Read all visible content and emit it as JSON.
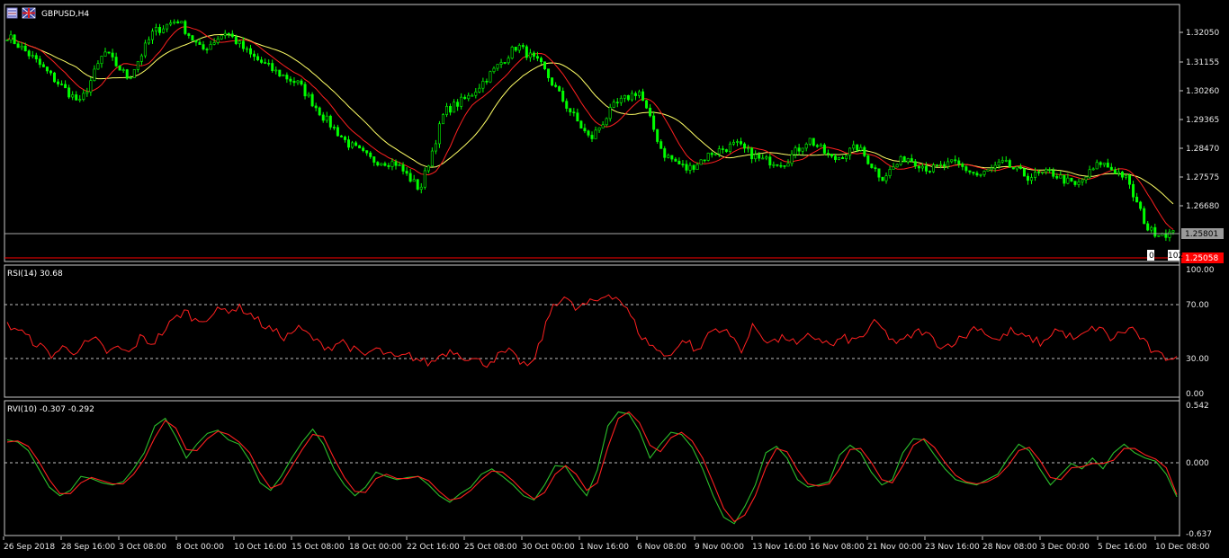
{
  "chart_title": "GBPUSD,H4",
  "colors": {
    "background": "#000000",
    "frame": "#c8c8c8",
    "bull_candle": "#00ff00",
    "bear_candle": "#00ff00",
    "ma_fast": "#ff2020",
    "ma_slow": "#ffff66",
    "rsi_line": "#ff2020",
    "rvi_main": "#2bbf2b",
    "rvi_signal": "#ff2020",
    "level_line": "#bfbfbf",
    "price_line": "#a8a8a8",
    "ask_line": "#ff0000",
    "ask_badge": "#ff0000",
    "bid_badge": "#9a9a9a"
  },
  "icons": [
    "chart-window-icon",
    "currency-flag-icon"
  ],
  "price_panel": {
    "y_ticks": [
      "1.32050",
      "1.31155",
      "1.30260",
      "1.29365",
      "1.28470",
      "1.27575",
      "1.26680"
    ],
    "bid_label": "1.25801",
    "ask_label": "1.25058",
    "corner_label": "0",
    "corner_label_2": "102"
  },
  "rsi_panel": {
    "label": "RSI(14) 30.68",
    "y_ticks": [
      "100.00",
      "70.00",
      "30.00",
      "0.00"
    ]
  },
  "rvi_panel": {
    "label": "RVI(10) -0.307 -0.292",
    "y_ticks": [
      "0.542",
      "0.000",
      "-0.637"
    ]
  },
  "x_ticks": [
    "26 Sep 2018",
    "28 Sep 16:00",
    "3 Oct 08:00",
    "8 Oct 00:00",
    "10 Oct 16:00",
    "15 Oct 08:00",
    "18 Oct 00:00",
    "22 Oct 16:00",
    "25 Oct 08:00",
    "30 Oct 00:00",
    "1 Nov 16:00",
    "6 Nov 08:00",
    "9 Nov 00:00",
    "13 Nov 16:00",
    "16 Nov 08:00",
    "21 Nov 00:00",
    "23 Nov 16:00",
    "28 Nov 08:00",
    "3 Dec 00:00",
    "5 Dec 16:00",
    "10 Dec 08:00"
  ],
  "chart_data": [
    {
      "type": "candlestick",
      "title": "GBPUSD,H4",
      "ylim": [
        1.2505,
        1.3255
      ],
      "x": [
        "26 Sep 2018",
        "28 Sep 16:00",
        "3 Oct 08:00",
        "8 Oct 00:00",
        "10 Oct 16:00",
        "15 Oct 08:00",
        "18 Oct 00:00",
        "22 Oct 16:00",
        "25 Oct 08:00",
        "30 Oct 00:00",
        "1 Nov 16:00",
        "6 Nov 08:00",
        "9 Nov 00:00",
        "13 Nov 16:00",
        "16 Nov 08:00",
        "21 Nov 00:00",
        "23 Nov 16:00",
        "28 Nov 08:00",
        "3 Dec 00:00",
        "5 Dec 16:00",
        "10 Dec 08:00"
      ],
      "close_path": [
        1.3195,
        1.313,
        1.3055,
        1.2985,
        1.3145,
        1.3062,
        1.3205,
        1.3245,
        1.3148,
        1.3208,
        1.3135,
        1.3085,
        1.3045,
        1.2945,
        1.2862,
        1.281,
        1.28,
        1.2718,
        1.296,
        1.3005,
        1.3085,
        1.3165,
        1.31,
        1.298,
        1.2872,
        1.2978,
        1.3025,
        1.283,
        1.278,
        1.2832,
        1.2858,
        1.281,
        1.2802,
        1.2875,
        1.281,
        1.285,
        1.2755,
        1.282,
        1.278,
        1.28,
        1.276,
        1.28,
        1.2758,
        1.277,
        1.2728,
        1.2802,
        1.276,
        1.259,
        1.258
      ],
      "bid": 1.25801,
      "ask": 1.25058
    },
    {
      "type": "line",
      "title": "RSI(14) 30.68",
      "ylim": [
        0,
        100
      ],
      "levels": [
        70,
        30
      ],
      "y_ticks": [
        100,
        70,
        30,
        0
      ],
      "values": [
        55,
        52,
        44,
        38,
        31,
        37,
        34,
        40,
        43,
        33,
        37,
        32,
        46,
        40,
        50,
        60,
        67,
        58,
        62,
        67,
        68,
        69,
        63,
        55,
        50,
        45,
        53,
        48,
        40,
        37,
        43,
        36,
        30,
        36,
        32,
        28,
        31,
        27,
        24,
        32,
        35,
        30,
        27,
        24,
        30,
        34,
        26,
        21,
        45,
        72,
        78,
        68,
        72,
        75,
        81,
        76,
        62,
        45,
        38,
        30,
        36,
        44,
        32,
        50,
        53,
        46,
        35,
        55,
        44,
        42,
        46,
        38,
        47,
        44,
        38,
        45,
        42,
        48,
        58,
        47,
        40,
        46,
        51,
        45,
        37,
        42,
        46,
        55,
        48,
        42,
        51,
        46,
        44,
        40,
        52,
        48,
        43,
        50,
        54,
        44,
        49,
        53,
        42,
        32,
        29,
        31
      ]
    },
    {
      "type": "line",
      "title": "RVI(10) -0.307 -0.292",
      "ylim": [
        -0.637,
        0.542
      ],
      "levels": [
        0
      ],
      "y_ticks": [
        0.542,
        0.0,
        -0.637
      ],
      "series": [
        {
          "name": "RVI(10)",
          "values": [
            0.22,
            0.2,
            0.12,
            -0.05,
            -0.22,
            -0.3,
            -0.25,
            -0.12,
            -0.14,
            -0.18,
            -0.2,
            -0.17,
            -0.05,
            0.1,
            0.35,
            0.42,
            0.25,
            0.05,
            0.18,
            0.28,
            0.31,
            0.22,
            0.18,
            0.03,
            -0.18,
            -0.25,
            -0.12,
            0.05,
            0.2,
            0.32,
            0.18,
            -0.05,
            -0.2,
            -0.3,
            -0.22,
            -0.08,
            -0.12,
            -0.15,
            -0.13,
            -0.12,
            -0.2,
            -0.3,
            -0.36,
            -0.28,
            -0.22,
            -0.1,
            -0.05,
            -0.12,
            -0.2,
            -0.3,
            -0.34,
            -0.2,
            -0.02,
            -0.03,
            -0.18,
            -0.3,
            -0.06,
            0.35,
            0.48,
            0.46,
            0.3,
            0.05,
            0.18,
            0.29,
            0.27,
            0.15,
            -0.05,
            -0.3,
            -0.5,
            -0.56,
            -0.4,
            -0.2,
            0.1,
            0.16,
            0.05,
            -0.15,
            -0.22,
            -0.2,
            -0.17,
            0.08,
            0.17,
            0.1,
            -0.08,
            -0.2,
            -0.15,
            0.1,
            0.23,
            0.22,
            0.08,
            -0.05,
            -0.15,
            -0.18,
            -0.2,
            -0.15,
            -0.1,
            0.05,
            0.18,
            0.12,
            -0.05,
            -0.2,
            -0.1,
            0.0,
            -0.05,
            0.05,
            -0.05,
            0.1,
            0.18,
            0.1,
            0.05,
            0.02,
            -0.1,
            -0.31
          ]
        },
        {
          "name": "Signal",
          "values": [
            0.2,
            0.21,
            0.16,
            0.02,
            -0.15,
            -0.28,
            -0.28,
            -0.18,
            -0.13,
            -0.16,
            -0.19,
            -0.19,
            -0.1,
            0.04,
            0.24,
            0.4,
            0.33,
            0.13,
            0.12,
            0.23,
            0.3,
            0.27,
            0.2,
            0.1,
            -0.09,
            -0.23,
            -0.19,
            -0.03,
            0.13,
            0.27,
            0.25,
            0.05,
            -0.13,
            -0.26,
            -0.27,
            -0.14,
            -0.1,
            -0.14,
            -0.14,
            -0.12,
            -0.16,
            -0.26,
            -0.34,
            -0.32,
            -0.25,
            -0.15,
            -0.07,
            -0.08,
            -0.16,
            -0.26,
            -0.33,
            -0.27,
            -0.1,
            -0.02,
            -0.1,
            -0.25,
            -0.18,
            0.15,
            0.42,
            0.48,
            0.38,
            0.17,
            0.11,
            0.24,
            0.29,
            0.21,
            0.05,
            -0.18,
            -0.42,
            -0.54,
            -0.48,
            -0.3,
            -0.04,
            0.14,
            0.11,
            -0.06,
            -0.19,
            -0.21,
            -0.19,
            -0.05,
            0.13,
            0.14,
            0.01,
            -0.15,
            -0.18,
            -0.02,
            0.17,
            0.23,
            0.15,
            0.01,
            -0.11,
            -0.17,
            -0.19,
            -0.17,
            -0.12,
            -0.02,
            0.12,
            0.15,
            0.03,
            -0.13,
            -0.15,
            -0.04,
            -0.03,
            0.0,
            0.0,
            0.03,
            0.14,
            0.14,
            0.08,
            0.04,
            -0.04,
            -0.29
          ]
        }
      ]
    }
  ]
}
